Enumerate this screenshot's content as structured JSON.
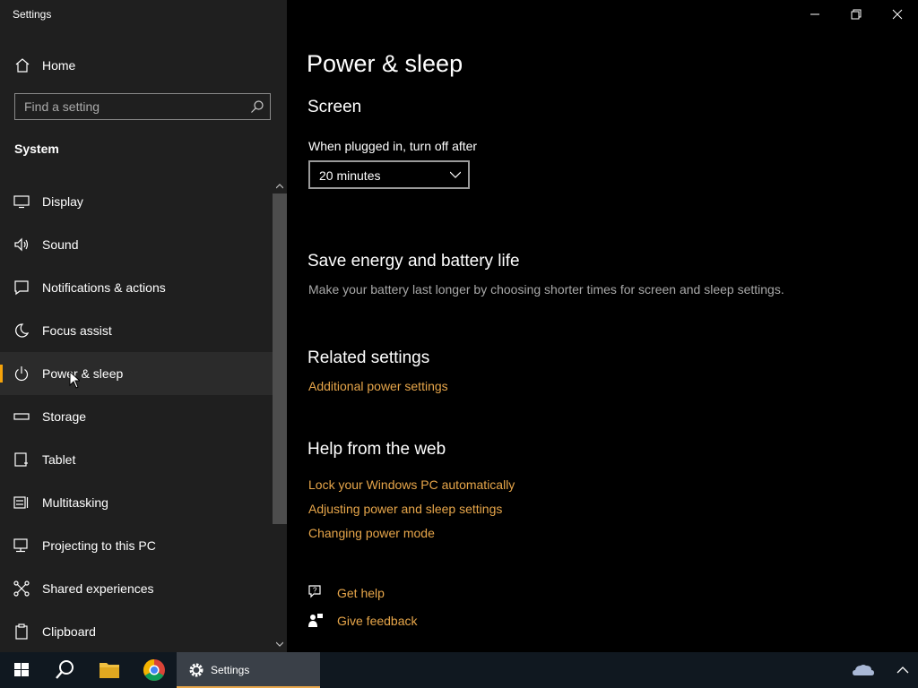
{
  "window": {
    "title": "Settings",
    "controls": [
      "minimize",
      "restore",
      "close"
    ]
  },
  "sidebar": {
    "home_label": "Home",
    "search_placeholder": "Find a setting",
    "section": "System",
    "items": [
      {
        "label": "Display",
        "icon": "display-icon"
      },
      {
        "label": "Sound",
        "icon": "sound-icon"
      },
      {
        "label": "Notifications & actions",
        "icon": "notifications-icon"
      },
      {
        "label": "Focus assist",
        "icon": "moon-icon"
      },
      {
        "label": "Power & sleep",
        "icon": "power-icon",
        "active": true
      },
      {
        "label": "Storage",
        "icon": "storage-icon"
      },
      {
        "label": "Tablet",
        "icon": "tablet-icon"
      },
      {
        "label": "Multitasking",
        "icon": "multitasking-icon"
      },
      {
        "label": "Projecting to this PC",
        "icon": "projecting-icon"
      },
      {
        "label": "Shared experiences",
        "icon": "shared-experiences-icon"
      },
      {
        "label": "Clipboard",
        "icon": "clipboard-icon"
      }
    ]
  },
  "main": {
    "title": "Power & sleep",
    "screen": {
      "heading": "Screen",
      "plugged_label": "When plugged in, turn off after",
      "plugged_value": "20 minutes"
    },
    "save_energy": {
      "heading": "Save energy and battery life",
      "description": "Make your battery last longer by choosing shorter times for screen and sleep settings."
    },
    "related": {
      "heading": "Related settings",
      "link": "Additional power settings"
    },
    "help": {
      "heading": "Help from the web",
      "links": [
        "Lock your Windows PC automatically",
        "Adjusting power and sleep settings",
        "Changing power mode"
      ]
    },
    "get_help": "Get help",
    "give_feedback": "Give feedback"
  },
  "taskbar": {
    "active_app": "Settings"
  },
  "colors": {
    "accent": "#f5a30a",
    "link": "#e7a64a",
    "sidebar_bg": "#1f1f1f",
    "main_bg": "#000000"
  }
}
